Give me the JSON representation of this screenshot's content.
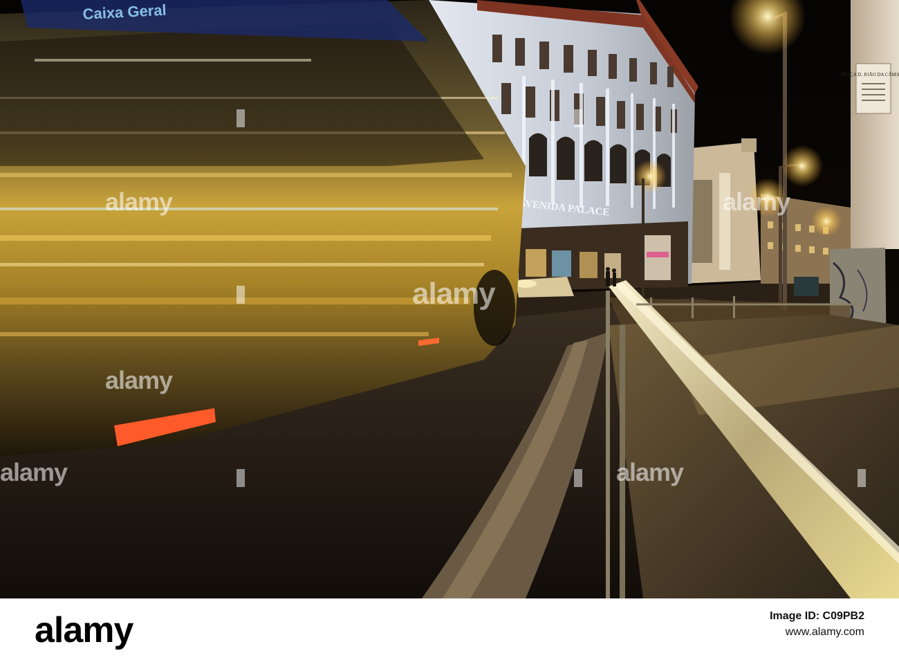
{
  "photo": {
    "bus_sign_text": "Caixa Geral",
    "building_sign_text": "AVENIDA PALACE",
    "street_plaque_text": "PRAÇA D. JOÃO DA CÂMARA",
    "colors": {
      "night_sky": "#0a0705",
      "bus_yellow": "#c89a2a",
      "facade": "#d9dde4",
      "street_light": "#fff2b0",
      "rail": "#c8c0a0"
    }
  },
  "watermark": {
    "text": "alamy"
  },
  "footer": {
    "logo": "alamy",
    "image_id_label": "Image ID: C09PB2",
    "url": "www.alamy.com"
  }
}
